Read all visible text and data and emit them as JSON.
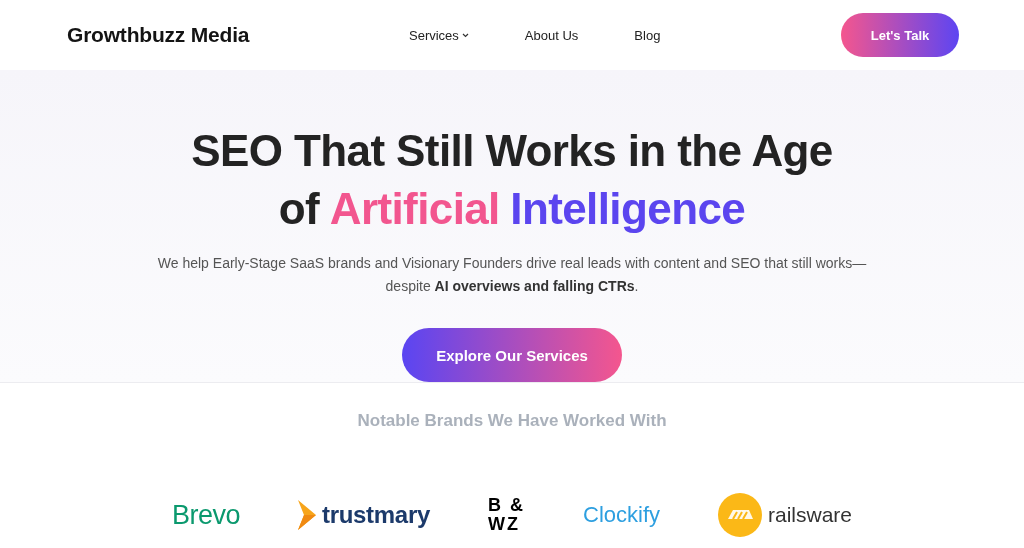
{
  "header": {
    "brand": "Growthbuzz Media",
    "nav": [
      {
        "label": "Services",
        "dropdown": true
      },
      {
        "label": "About Us",
        "dropdown": false
      },
      {
        "label": "Blog",
        "dropdown": false
      }
    ],
    "cta": "Let's Talk"
  },
  "hero": {
    "headline_lines": [
      [
        {
          "text": "SEO That Still Works in the Age"
        }
      ],
      [
        {
          "text": "of"
        },
        {
          "text": "Artificial",
          "color": "#f2568f"
        },
        {
          "text": "Intelligence",
          "color": "#5b45ef"
        }
      ]
    ],
    "subtitle": "We help Early-Stage SaaS brands and Visionary Founders drive real leads with content and SEO that still works— despite **AI overviews and falling CTRs**.",
    "button": "Explore Our Services"
  },
  "brands": {
    "title": "Notable Brands We Have Worked With",
    "logos": [
      {
        "kind": "brevo",
        "text": "Brevo"
      },
      {
        "kind": "trustmary",
        "text": "trustmary"
      },
      {
        "kind": "bwz",
        "lines": [
          "B &",
          "WZ"
        ]
      },
      {
        "kind": "clockify",
        "text": "Clockify"
      },
      {
        "kind": "railsware",
        "text": "railsware"
      }
    ]
  }
}
